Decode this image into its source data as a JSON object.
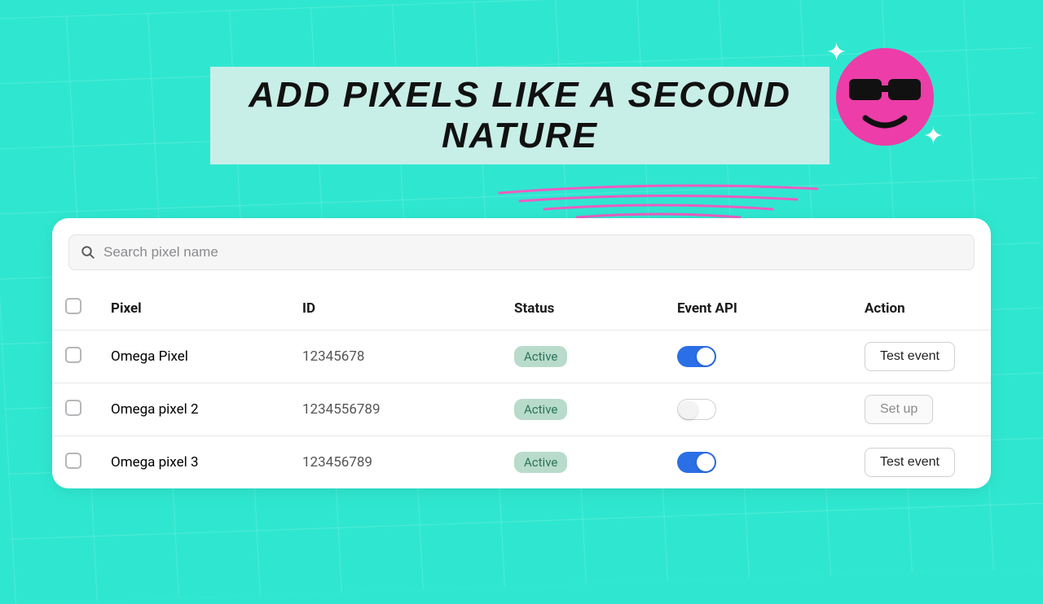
{
  "headline": "ADD PIXELS LIKE A SECOND NATURE",
  "search": {
    "placeholder": "Search pixel name"
  },
  "columns": {
    "pixel": "Pixel",
    "id": "ID",
    "status": "Status",
    "event_api": "Event API",
    "action": "Action"
  },
  "rows": [
    {
      "pixel": "Omega Pixel",
      "id": "12345678",
      "status": "Active",
      "event_api_on": true,
      "action_label": "Test event",
      "action_muted": false
    },
    {
      "pixel": "Omega pixel 2",
      "id": "1234556789",
      "status": "Active",
      "event_api_on": false,
      "action_label": "Set up",
      "action_muted": true
    },
    {
      "pixel": "Omega pixel 3",
      "id": "123456789",
      "status": "Active",
      "event_api_on": true,
      "action_label": "Test event",
      "action_muted": false
    }
  ]
}
